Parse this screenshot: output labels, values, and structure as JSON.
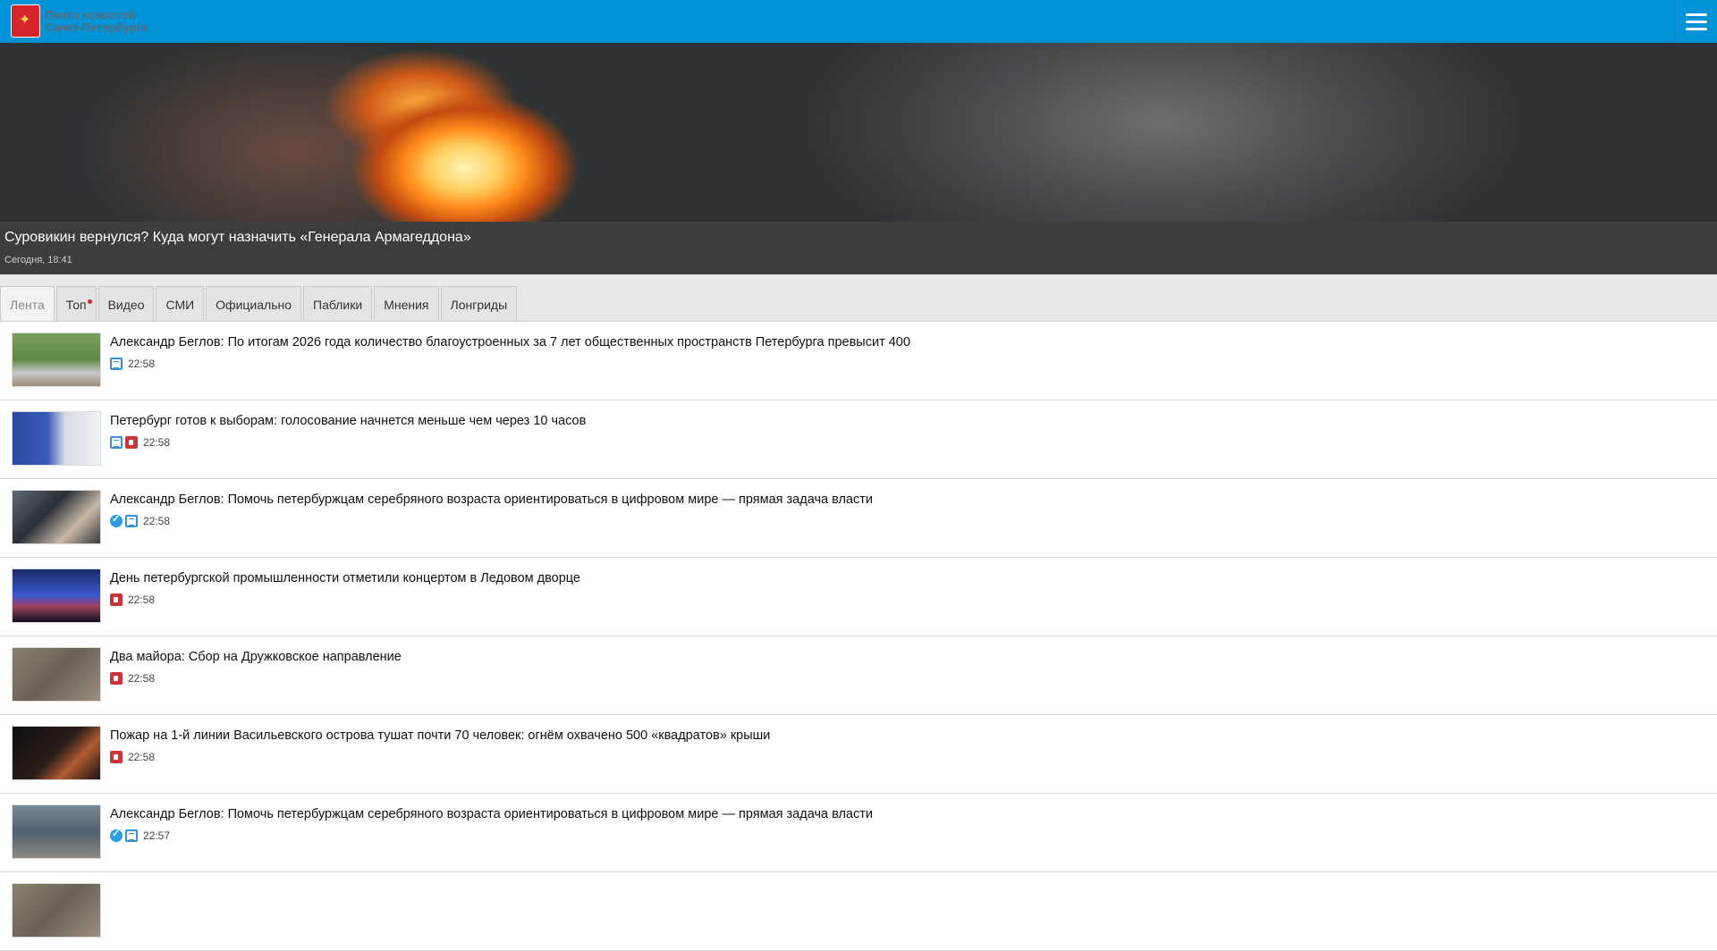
{
  "header": {
    "brand_line1": "Лента новостей",
    "brand_line2": "Санкт-Петербурга",
    "menu_icon": "hamburger-icon",
    "accent": "#0093d8"
  },
  "hero": {
    "title": "Суровикин вернулся? Куда могут назначить «Генерала Армагеддона»",
    "time": "Сегодня, 18:41"
  },
  "tabs": [
    {
      "label": "Лента",
      "active": true
    },
    {
      "label": "Топ",
      "badge": true
    },
    {
      "label": "Видео"
    },
    {
      "label": "СМИ"
    },
    {
      "label": "Официально"
    },
    {
      "label": "Паблики"
    },
    {
      "label": "Мнения"
    },
    {
      "label": "Лонгриды"
    }
  ],
  "news": [
    {
      "title": "Александр Беглов: По итогам 2026 года количество благоустроенных за 7 лет общественных пространств Петербурга превысит 400",
      "icons": [
        "text-icon"
      ],
      "time": "22:58"
    },
    {
      "title": "Петербург готов к выборам: голосование начнется меньше чем через 10 часов",
      "icons": [
        "text-icon",
        "video-icon"
      ],
      "time": "22:58"
    },
    {
      "title": "Александр Беглов: Помочь петербуржцам серебряного возраста ориентироваться в цифровом мире — прямая задача власти",
      "icons": [
        "verified-icon",
        "text-icon"
      ],
      "time": "22:58"
    },
    {
      "title": "День петербургской промышленности отметили концертом в Ледовом дворце",
      "icons": [
        "video-icon"
      ],
      "time": "22:58"
    },
    {
      "title": "Два майора: Сбор на Дружковское направление",
      "icons": [
        "video-icon"
      ],
      "time": "22:58"
    },
    {
      "title": "Пожар на 1-й линии Васильевского острова тушат почти 70 человек: огнём охвачено 500 «квадратов» крыши",
      "icons": [
        "video-icon"
      ],
      "time": "22:58"
    },
    {
      "title": "Александр Беглов: Помочь петербуржцам серебряного возраста ориентироваться в цифровом мире — прямая задача власти",
      "icons": [
        "verified-icon",
        "text-icon"
      ],
      "time": "22:57"
    }
  ]
}
